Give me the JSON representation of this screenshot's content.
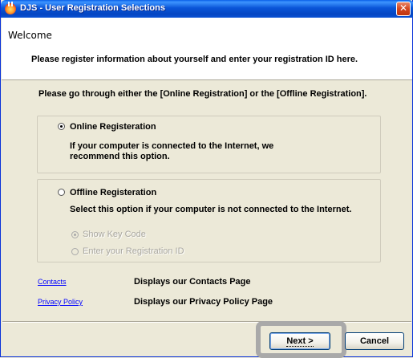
{
  "window": {
    "title": "DJS - User Registration Selections",
    "close_glyph": "✕",
    "app_icon": "djs-app-icon"
  },
  "header": {
    "welcome": "Welcome",
    "description": "Please register information about yourself and enter your registration ID here."
  },
  "intro": "Please go through either the [Online Registration] or the [Offline Registration].",
  "online": {
    "label": "Online Registeration",
    "selected": true,
    "description": "If your computer is connected to the Internet, we recommend this option."
  },
  "offline": {
    "label": "Offline Registeration",
    "selected": false,
    "description": "Select this option if your computer is not connected to the Internet.",
    "sub_options": [
      {
        "label": "Show Key Code",
        "selected": true,
        "enabled": false
      },
      {
        "label": "Enter your Registration ID",
        "selected": false,
        "enabled": false
      }
    ]
  },
  "links": [
    {
      "label": "Contacts",
      "description": "Displays our Contacts Page"
    },
    {
      "label": "Privacy Policy",
      "description": "Displays our Privacy Policy Page"
    }
  ],
  "buttons": {
    "next": "Next >",
    "cancel": "Cancel"
  },
  "colors": {
    "titlebar": "#0a55d8",
    "link": "#0000ff",
    "disabled_text": "#a9a7a0",
    "highlight": "#a9a9a9"
  }
}
